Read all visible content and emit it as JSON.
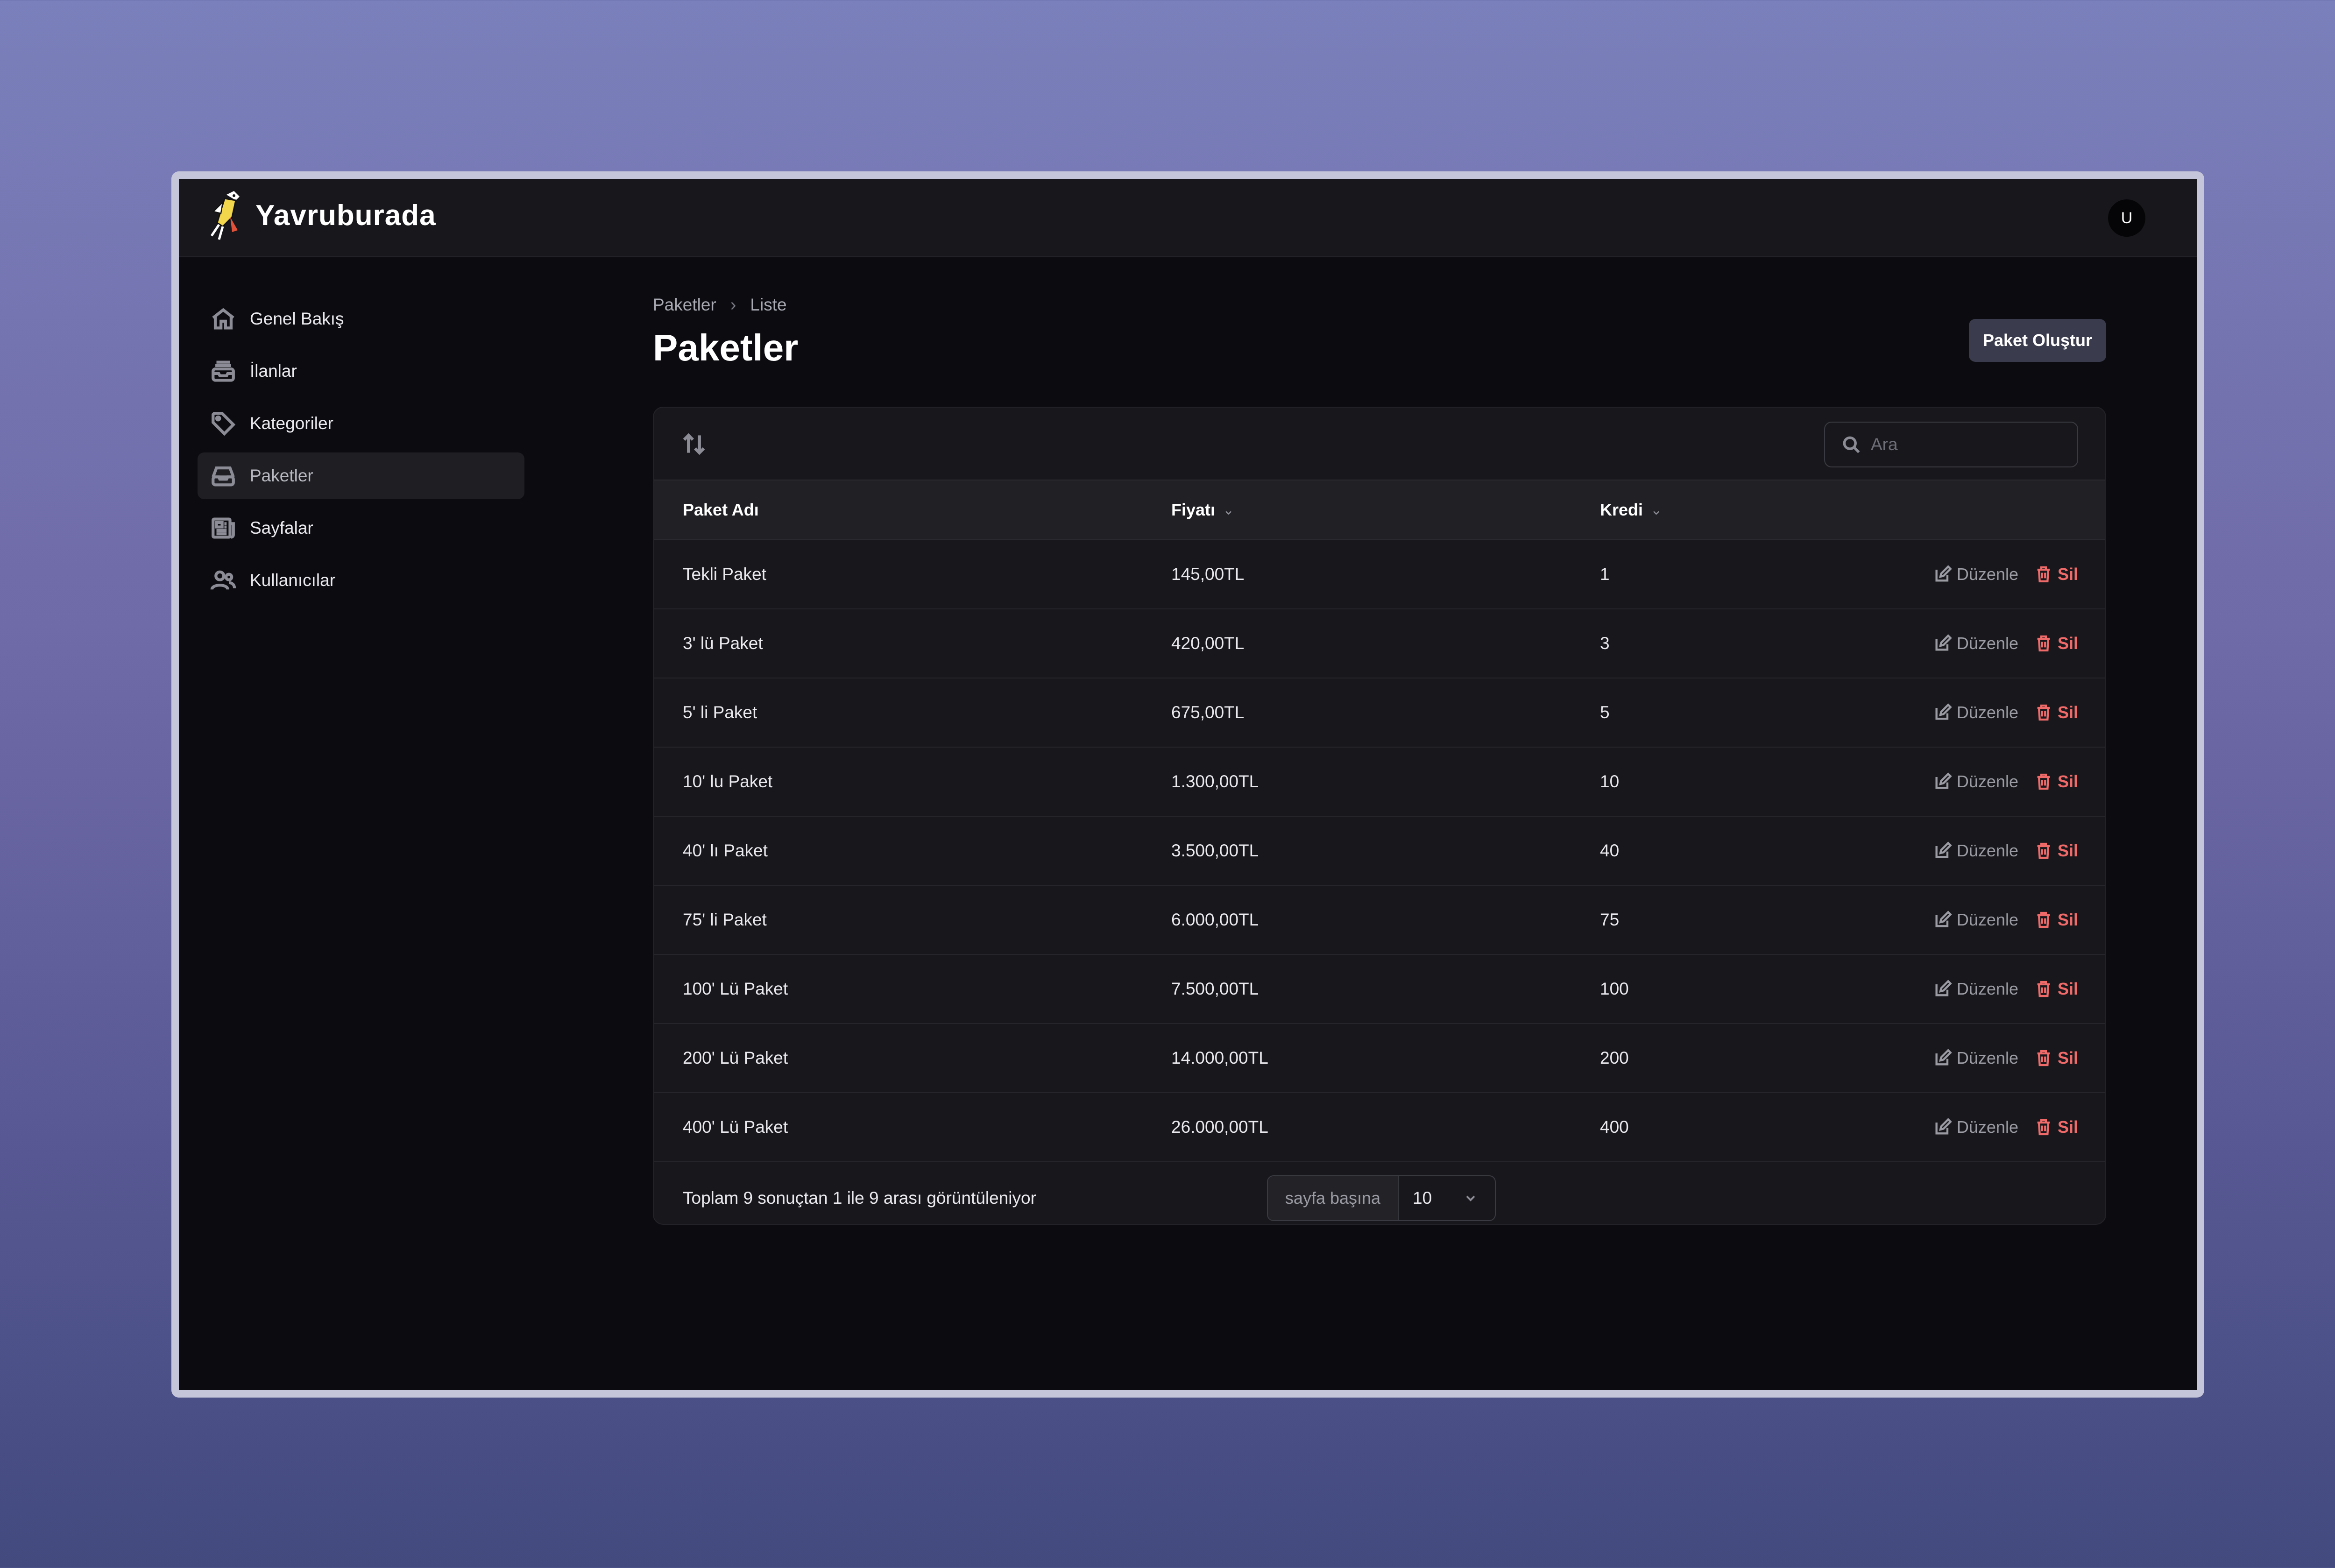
{
  "app": {
    "name": "Yavruburada",
    "user_initial": "U"
  },
  "sidebar": {
    "items": [
      {
        "label": "Genel Bakış",
        "icon": "home-icon"
      },
      {
        "label": "İlanlar",
        "icon": "inbox-stack-icon"
      },
      {
        "label": "Kategoriler",
        "icon": "tag-icon"
      },
      {
        "label": "Paketler",
        "icon": "inbox-icon",
        "active": true
      },
      {
        "label": "Sayfalar",
        "icon": "newspaper-icon"
      },
      {
        "label": "Kullanıcılar",
        "icon": "users-icon"
      }
    ]
  },
  "breadcrumb": {
    "parent": "Paketler",
    "current": "Liste"
  },
  "page": {
    "title": "Paketler",
    "create_label": "Paket Oluştur"
  },
  "search": {
    "placeholder": "Ara",
    "value": ""
  },
  "table": {
    "columns": [
      "Paket Adı",
      "Fiyatı",
      "Kredi"
    ],
    "rows": [
      {
        "name": "Tekli Paket",
        "price": "145,00TL",
        "credit": "1"
      },
      {
        "name": "3' lü Paket",
        "price": "420,00TL",
        "credit": "3"
      },
      {
        "name": "5' li Paket",
        "price": "675,00TL",
        "credit": "5"
      },
      {
        "name": "10' lu Paket",
        "price": "1.300,00TL",
        "credit": "10"
      },
      {
        "name": "40' lı Paket",
        "price": "3.500,00TL",
        "credit": "40"
      },
      {
        "name": "75' li Paket",
        "price": "6.000,00TL",
        "credit": "75"
      },
      {
        "name": "100' Lü Paket",
        "price": "7.500,00TL",
        "credit": "100"
      },
      {
        "name": "200' Lü Paket",
        "price": "14.000,00TL",
        "credit": "200"
      },
      {
        "name": "400' Lü Paket",
        "price": "26.000,00TL",
        "credit": "400"
      }
    ],
    "edit_label": "Düzenle",
    "delete_label": "Sil"
  },
  "pagination": {
    "summary": "Toplam 9 sonuçtan 1 ile 9 arası görüntüleniyor",
    "per_page_label": "sayfa başına",
    "per_page_value": "10"
  },
  "colors": {
    "accent_danger": "#f06a6a",
    "panel": "#18181c",
    "topbar": "#18181c"
  }
}
